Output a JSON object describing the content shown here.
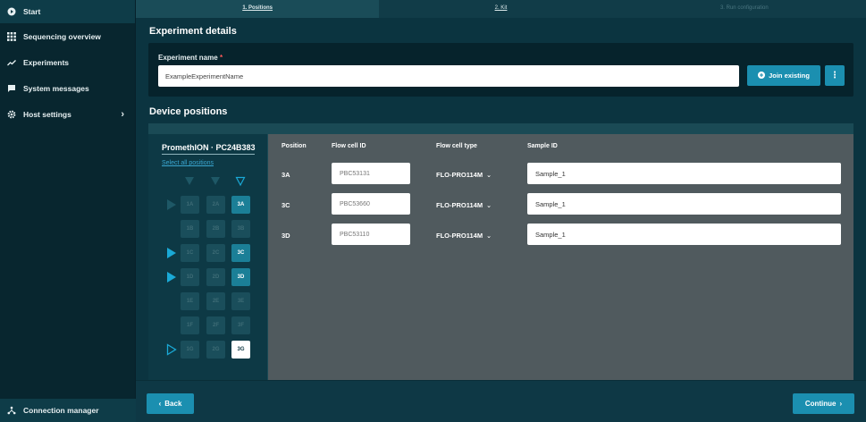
{
  "sidebar": {
    "items": [
      {
        "label": "Start",
        "icon": "play-circle-icon"
      },
      {
        "label": "Sequencing overview",
        "icon": "grid-icon"
      },
      {
        "label": "Experiments",
        "icon": "chart-line-icon"
      },
      {
        "label": "System messages",
        "icon": "message-icon"
      },
      {
        "label": "Host settings",
        "icon": "gear-icon"
      }
    ],
    "connection_manager": "Connection manager"
  },
  "stepper": {
    "steps": [
      "1. Positions",
      "2. Kit",
      "3. Run configuration"
    ]
  },
  "experiment": {
    "section_title": "Experiment details",
    "name_label": "Experiment name",
    "required_mark": "*",
    "name_value": "ExampleExperimentName",
    "join_label": "Join existing",
    "more_label": "⋮"
  },
  "device": {
    "section_title": "Device positions",
    "name": "PromethION · PC24B383",
    "select_all": "Select all positions",
    "grid_rows": [
      {
        "play": "dim",
        "cells": [
          "1A",
          "2A",
          "3A"
        ],
        "selected": 2
      },
      {
        "play": "none",
        "cells": [
          "1B",
          "2B",
          "3B"
        ],
        "selected": -1
      },
      {
        "play": "on",
        "cells": [
          "1C",
          "2C",
          "3C"
        ],
        "selected": 2
      },
      {
        "play": "on",
        "cells": [
          "1D",
          "2D",
          "3D"
        ],
        "selected": 2
      },
      {
        "play": "none",
        "cells": [
          "1E",
          "2E",
          "3E"
        ],
        "selected": -1
      },
      {
        "play": "none",
        "cells": [
          "1F",
          "2F",
          "3F"
        ],
        "selected": -1
      },
      {
        "play": "outline",
        "cells": [
          "1G",
          "2G",
          "3G"
        ],
        "selected": 2,
        "white": true
      }
    ]
  },
  "table": {
    "headers": [
      "Position",
      "Flow cell ID",
      "Flow cell type",
      "Sample ID"
    ],
    "rows": [
      {
        "position": "3A",
        "flow_cell_id": "PBC53131",
        "flow_cell_type": "FLO-PRO114M",
        "sample_id": "Sample_1"
      },
      {
        "position": "3C",
        "flow_cell_id": "PBC53660",
        "flow_cell_type": "FLO-PRO114M",
        "sample_id": "Sample_1"
      },
      {
        "position": "3D",
        "flow_cell_id": "PBC53110",
        "flow_cell_type": "FLO-PRO114M",
        "sample_id": "Sample_1"
      }
    ]
  },
  "footer": {
    "back_label": "Back",
    "continue_label": "Continue"
  },
  "colors": {
    "accent": "#1b8fb0",
    "background": "#0b3440",
    "sidebar": "#08262f",
    "required": "#ff5a5a"
  }
}
